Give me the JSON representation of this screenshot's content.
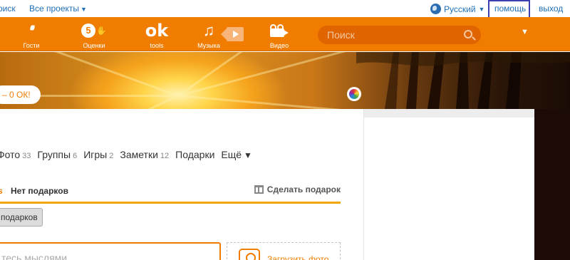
{
  "topbar": {
    "search_link": "оиск",
    "projects": "Все проекты",
    "language": "Русский",
    "help": "помощь",
    "logout": "выход"
  },
  "nav": {
    "items": [
      {
        "label": "Гости",
        "icon": "footprints-icon"
      },
      {
        "label": "Оценки",
        "icon": "ratings-icon",
        "glyph": "5"
      },
      {
        "label": "tools",
        "icon": "ok-logo-icon",
        "glyph": "ok"
      },
      {
        "label": "Музыка",
        "icon": "music-note-icon",
        "glyph": "♫"
      },
      {
        "label": "Видео",
        "icon": "video-camera-icon"
      }
    ],
    "search_placeholder": "Поиск",
    "more_glyph": "▼"
  },
  "cover": {
    "pill_text": "– 0 ОК!"
  },
  "tabs": [
    {
      "label": "Фото",
      "count": "33"
    },
    {
      "label": "Группы",
      "count": "6"
    },
    {
      "label": "Игры",
      "count": "2"
    },
    {
      "label": "Заметки",
      "count": "12"
    },
    {
      "label": "Подарки",
      "count": ""
    },
    {
      "label": "Ещё",
      "count": "",
      "caret": "▼"
    }
  ],
  "gifts": {
    "mark": "s",
    "title": "Нет подарков",
    "make_gift": "Сделать подарок",
    "button": "подарков"
  },
  "status": {
    "placeholder": "тесь мыслями"
  },
  "upload": {
    "label": "Загрузить фото"
  },
  "colors": {
    "accent": "#f07d00",
    "link": "#1f6fb5",
    "gold_line": "#f0a800"
  }
}
